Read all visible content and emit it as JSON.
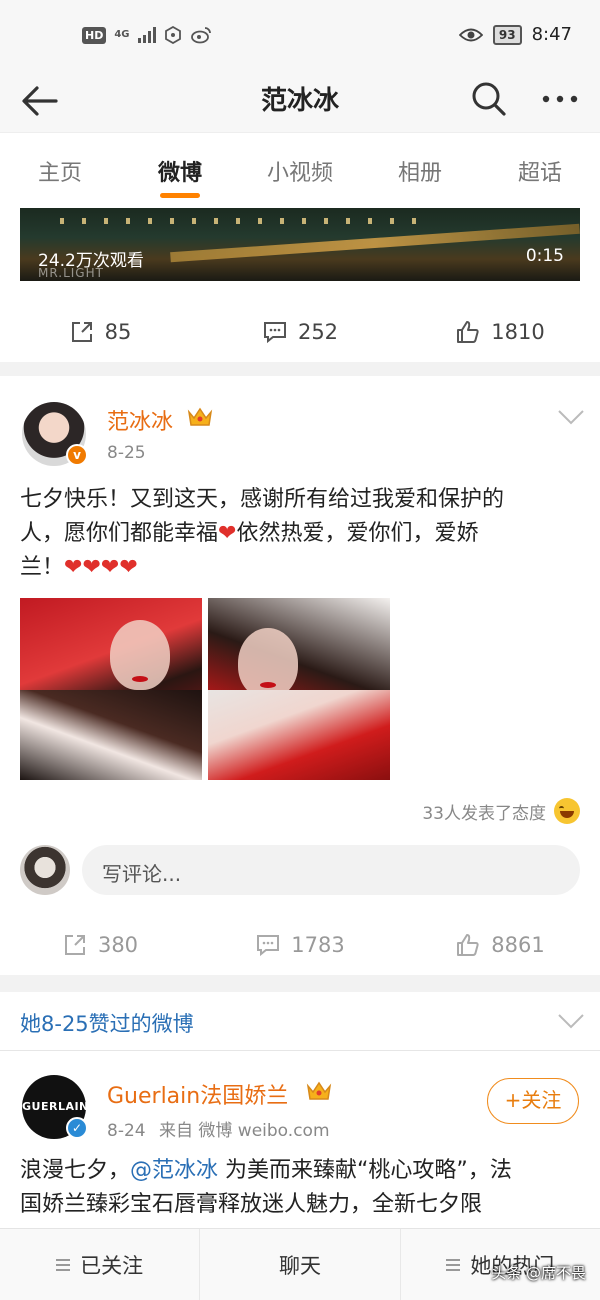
{
  "status_bar": {
    "left": {
      "hd": "HD",
      "network": "4G"
    },
    "battery": "93",
    "time": "8:47"
  },
  "header": {
    "title": "范冰冰"
  },
  "tabs": [
    {
      "label": "主页",
      "active": false
    },
    {
      "label": "微博",
      "active": true
    },
    {
      "label": "小视频",
      "active": false
    },
    {
      "label": "相册",
      "active": false
    },
    {
      "label": "超话",
      "active": false
    }
  ],
  "video_post": {
    "views": "24.2万次观看",
    "duration": "0:15",
    "watermark": "MR.LIGHT",
    "actions": {
      "repost": "85",
      "comments": "252",
      "likes": "1810"
    }
  },
  "post": {
    "username": "范冰冰",
    "date": "8-25",
    "verified_badge": "v",
    "text_lines": [
      "七夕快乐！又到这天，感谢所有给过我爱和保护的",
      "人，愿你们都能幸福",
      "依然热爱，爱你们，爱娇",
      "兰！"
    ],
    "hearts": "❤",
    "hearts_row": "❤❤❤❤",
    "reactions_text": "33人发表了态度",
    "comment_placeholder": "写评论...",
    "actions": {
      "repost": "380",
      "comments": "1783",
      "likes": "8861"
    }
  },
  "liked_section": {
    "label": "她8-25赞过的微博"
  },
  "second_post": {
    "username": "Guerlain法国娇兰",
    "avatar_text": "GUERLAIN",
    "date": "8-24",
    "source": "来自 微博 weibo.com",
    "follow_label": "+关注",
    "text_line1_prefix": "浪漫七夕，",
    "text_line1_mention": "@范冰冰",
    "text_line1_suffix": " 为美而来臻献“桃心攻略”，法",
    "text_line2": "国娇兰臻彩宝石唇膏释放迷人魅力，全新七夕限"
  },
  "bottom_bar": {
    "items": [
      "已关注",
      "聊天",
      "她的热门"
    ]
  },
  "watermark_overlay": "头条 @席不畏",
  "colors": {
    "accent": "#ff8200",
    "username": "#e86d13",
    "link": "#2a6fb5"
  }
}
